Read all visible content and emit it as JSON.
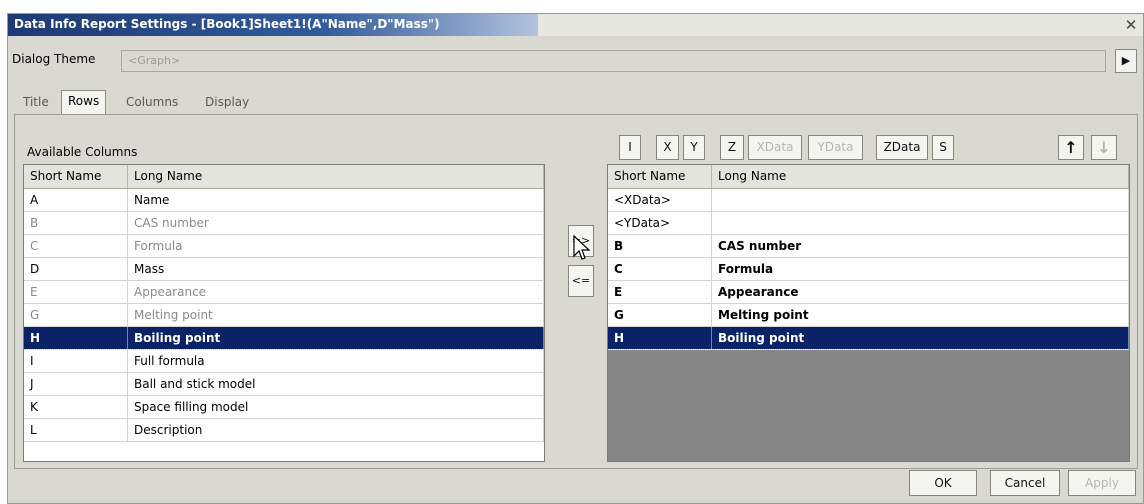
{
  "window": {
    "title": "Data Info Report Settings - [Book1]Sheet1!(A\"Name\",D\"Mass\")",
    "close_icon": "close-icon"
  },
  "theme": {
    "label": "Dialog Theme",
    "value": "<Graph>"
  },
  "tabs": [
    {
      "label": "Title"
    },
    {
      "label": "Rows"
    },
    {
      "label": "Columns"
    },
    {
      "label": "Display"
    }
  ],
  "available": {
    "label": "Available Columns",
    "headers": [
      "Short Name",
      "Long Name"
    ],
    "rows": [
      {
        "short": "A",
        "long": "Name"
      },
      {
        "short": "B",
        "long": "CAS number"
      },
      {
        "short": "C",
        "long": "Formula"
      },
      {
        "short": "D",
        "long": "Mass"
      },
      {
        "short": "E",
        "long": "Appearance"
      },
      {
        "short": "G",
        "long": "Melting point"
      },
      {
        "short": "H",
        "long": "Boiling point"
      },
      {
        "short": "I",
        "long": "Full formula"
      },
      {
        "short": "J",
        "long": "Ball and stick model"
      },
      {
        "short": "K",
        "long": "Space filling model"
      },
      {
        "short": "L",
        "long": "Description"
      }
    ]
  },
  "move": {
    "add": "=>",
    "remove": "<="
  },
  "toolbar": [
    "I",
    "X",
    "Y",
    "Z",
    "XData",
    "YData",
    "ZData",
    "S"
  ],
  "selected": {
    "headers": [
      "Short Name",
      "Long Name"
    ],
    "rows": [
      {
        "short": "<XData>",
        "long": ""
      },
      {
        "short": "<YData>",
        "long": ""
      },
      {
        "short": "B",
        "long": "CAS number"
      },
      {
        "short": "C",
        "long": "Formula"
      },
      {
        "short": "E",
        "long": "Appearance"
      },
      {
        "short": "G",
        "long": "Melting point"
      },
      {
        "short": "H",
        "long": "Boiling point"
      }
    ]
  },
  "buttons": {
    "ok": "OK",
    "cancel": "Cancel",
    "apply": "Apply"
  },
  "icons": {
    "theme_arrow": "play-right-icon",
    "up": "arrow-up-icon",
    "down": "arrow-down-icon"
  }
}
